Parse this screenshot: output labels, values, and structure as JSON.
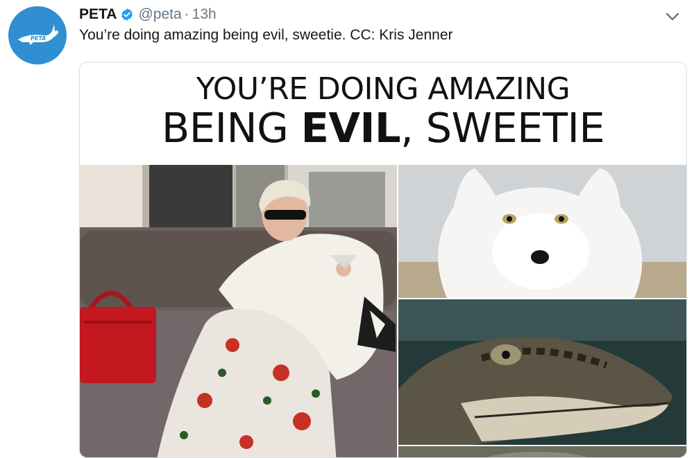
{
  "tweet": {
    "name": "PETA",
    "handle": "@peta",
    "separator": "·",
    "time": "13h",
    "text": "You’re doing amazing being evil, sweetie. CC: Kris Jenner",
    "avatar_logo_text": "PETA"
  },
  "image": {
    "headline_line1": "YOU’RE DOING AMAZING",
    "headline_line2_pre": "BEING ",
    "headline_line2_bold": "EVIL",
    "headline_line2_post": ", SWEETIE"
  },
  "colors": {
    "brand_blue": "#2f8fd0",
    "verified_blue": "#1da1f2",
    "muted_text": "#657786",
    "main_text": "#14171a"
  },
  "icons": [
    "verified-badge-icon",
    "chevron-down-icon",
    "peta-rabbit-logo-icon"
  ]
}
